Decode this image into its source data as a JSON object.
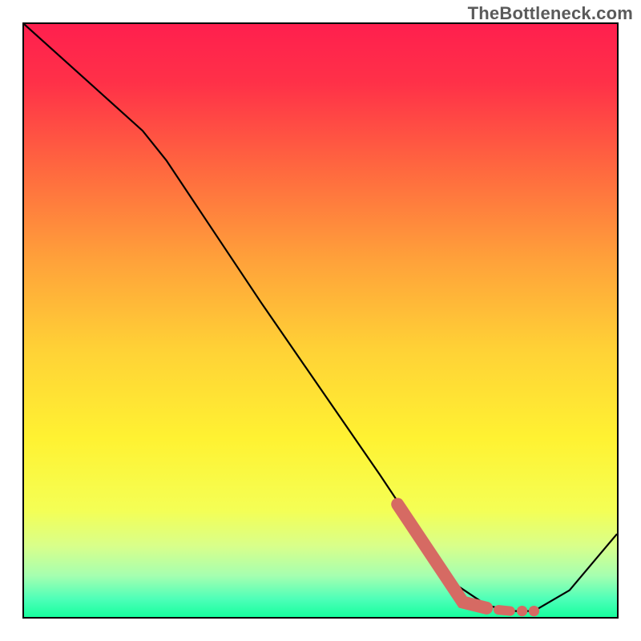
{
  "watermark": "TheBottleneck.com",
  "chart_data": {
    "type": "line",
    "title": "",
    "xlabel": "",
    "ylabel": "",
    "xlim": [
      0,
      100
    ],
    "ylim": [
      0,
      100
    ],
    "series": [
      {
        "name": "curve",
        "x": [
          0,
          10,
          20,
          24,
          30,
          40,
          50,
          60,
          66,
          72,
          78,
          82,
          86,
          92,
          100
        ],
        "y": [
          100,
          91,
          82,
          77,
          68,
          53,
          38.5,
          24,
          15,
          6,
          2,
          1,
          1,
          4.5,
          14
        ]
      },
      {
        "name": "highlight",
        "x": [
          63,
          65,
          70,
          74,
          78,
          80,
          82,
          84,
          86
        ],
        "y": [
          19,
          16,
          8.5,
          2.5,
          1.5,
          1.2,
          1.0,
          1.0,
          1.0
        ]
      }
    ],
    "gradient_stops": [
      {
        "offset": 0.0,
        "color": "#ff1f4e"
      },
      {
        "offset": 0.1,
        "color": "#ff3148"
      },
      {
        "offset": 0.25,
        "color": "#ff6a3f"
      },
      {
        "offset": 0.4,
        "color": "#ffa23a"
      },
      {
        "offset": 0.55,
        "color": "#ffd236"
      },
      {
        "offset": 0.7,
        "color": "#fff232"
      },
      {
        "offset": 0.82,
        "color": "#f4ff55"
      },
      {
        "offset": 0.88,
        "color": "#d9ff8a"
      },
      {
        "offset": 0.93,
        "color": "#a6ffb0"
      },
      {
        "offset": 0.97,
        "color": "#4dffb8"
      },
      {
        "offset": 1.0,
        "color": "#17ff9e"
      }
    ]
  }
}
